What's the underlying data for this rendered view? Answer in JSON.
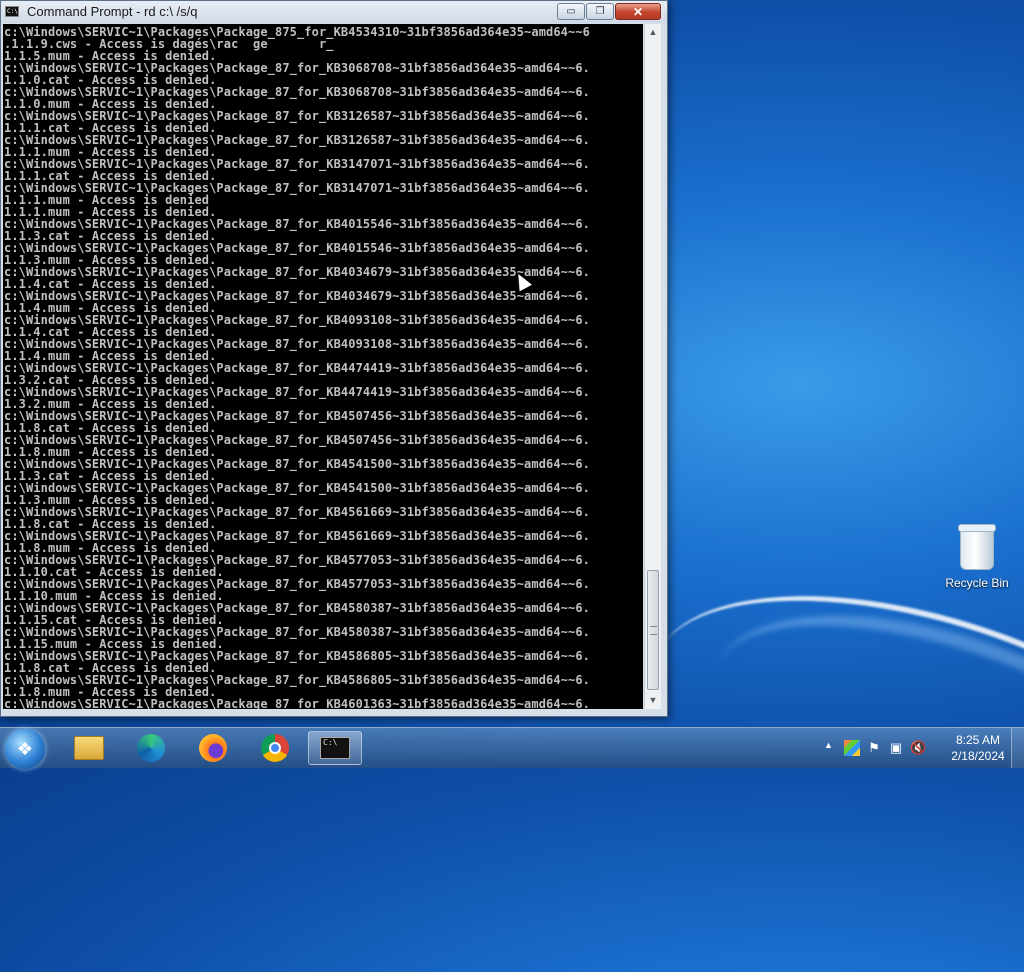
{
  "window": {
    "title": "Command Prompt - rd  c:\\ /s/q",
    "buttons": {
      "minimize": "▭",
      "maximize": "❐",
      "close": "✕"
    },
    "icon_text": "C:\\"
  },
  "console": {
    "lines": [
      "c:\\Windows\\SERVIC~1\\Packages\\Package_875_for_KB4534310~31bf3856ad364e35~amd64~~6",
      ".1.1.9.cws - Access is dagés\\rac  ge       r_",
      "1.1.5.mum - Access is denied.",
      "c:\\Windows\\SERVIC~1\\Packages\\Package_87_for_KB3068708~31bf3856ad364e35~amd64~~6.",
      "1.1.0.cat - Access is denied.",
      "c:\\Windows\\SERVIC~1\\Packages\\Package_87_for_KB3068708~31bf3856ad364e35~amd64~~6.",
      "1.1.0.mum - Access is denied.",
      "c:\\Windows\\SERVIC~1\\Packages\\Package_87_for_KB3126587~31bf3856ad364e35~amd64~~6.",
      "1.1.1.cat - Access is denied.",
      "c:\\Windows\\SERVIC~1\\Packages\\Package_87_for_KB3126587~31bf3856ad364e35~amd64~~6.",
      "1.1.1.mum - Access is denied.",
      "c:\\Windows\\SERVIC~1\\Packages\\Package_87_for_KB3147071~31bf3856ad364e35~amd64~~6.",
      "1.1.1.cat - Access is denied.",
      "c:\\Windows\\SERVIC~1\\Packages\\Package_87_for_KB3147071~31bf3856ad364e35~amd64~~6.",
      "1.1.1.mum - Access is denied",
      "1.1.1.mum - Access is denied.",
      "c:\\Windows\\SERVIC~1\\Packages\\Package_87_for_KB4015546~31bf3856ad364e35~amd64~~6.",
      "1.1.3.cat - Access is denied.",
      "c:\\Windows\\SERVIC~1\\Packages\\Package_87_for_KB4015546~31bf3856ad364e35~amd64~~6.",
      "1.1.3.mum - Access is denied.",
      "c:\\Windows\\SERVIC~1\\Packages\\Package_87_for_KB4034679~31bf3856ad364e35~amd64~~6.",
      "1.1.4.cat - Access is denied.",
      "c:\\Windows\\SERVIC~1\\Packages\\Package_87_for_KB4034679~31bf3856ad364e35~amd64~~6.",
      "1.1.4.mum - Access is denied.",
      "c:\\Windows\\SERVIC~1\\Packages\\Package_87_for_KB4093108~31bf3856ad364e35~amd64~~6.",
      "1.1.4.cat - Access is denied.",
      "c:\\Windows\\SERVIC~1\\Packages\\Package_87_for_KB4093108~31bf3856ad364e35~amd64~~6.",
      "1.1.4.mum - Access is denied.",
      "c:\\Windows\\SERVIC~1\\Packages\\Package_87_for_KB4474419~31bf3856ad364e35~amd64~~6.",
      "1.3.2.cat - Access is denied.",
      "c:\\Windows\\SERVIC~1\\Packages\\Package_87_for_KB4474419~31bf3856ad364e35~amd64~~6.",
      "1.3.2.mum - Access is denied.",
      "c:\\Windows\\SERVIC~1\\Packages\\Package_87_for_KB4507456~31bf3856ad364e35~amd64~~6.",
      "1.1.8.cat - Access is denied.",
      "c:\\Windows\\SERVIC~1\\Packages\\Package_87_for_KB4507456~31bf3856ad364e35~amd64~~6.",
      "1.1.8.mum - Access is denied.",
      "c:\\Windows\\SERVIC~1\\Packages\\Package_87_for_KB4541500~31bf3856ad364e35~amd64~~6.",
      "1.1.3.cat - Access is denied.",
      "c:\\Windows\\SERVIC~1\\Packages\\Package_87_for_KB4541500~31bf3856ad364e35~amd64~~6.",
      "1.1.3.mum - Access is denied.",
      "c:\\Windows\\SERVIC~1\\Packages\\Package_87_for_KB4561669~31bf3856ad364e35~amd64~~6.",
      "1.1.8.cat - Access is denied.",
      "c:\\Windows\\SERVIC~1\\Packages\\Package_87_for_KB4561669~31bf3856ad364e35~amd64~~6.",
      "1.1.8.mum - Access is denied.",
      "c:\\Windows\\SERVIC~1\\Packages\\Package_87_for_KB4577053~31bf3856ad364e35~amd64~~6.",
      "1.1.10.cat - Access is denied.",
      "c:\\Windows\\SERVIC~1\\Packages\\Package_87_for_KB4577053~31bf3856ad364e35~amd64~~6.",
      "1.1.10.mum - Access is denied.",
      "c:\\Windows\\SERVIC~1\\Packages\\Package_87_for_KB4580387~31bf3856ad364e35~amd64~~6.",
      "1.1.15.cat - Access is denied.",
      "c:\\Windows\\SERVIC~1\\Packages\\Package_87_for_KB4580387~31bf3856ad364e35~amd64~~6.",
      "1.1.15.mum - Access is denied.",
      "c:\\Windows\\SERVIC~1\\Packages\\Package_87_for_KB4586805~31bf3856ad364e35~amd64~~6.",
      "1.1.8.cat - Access is denied.",
      "c:\\Windows\\SERVIC~1\\Packages\\Package_87_for_KB4586805~31bf3856ad364e35~amd64~~6.",
      "1.1.8.mum - Access is denied.",
      "c:\\Windows\\SERVIC~1\\Packages\\Package_87_for_KB4601363~31bf3856ad364e35~amd64~~6."
    ]
  },
  "desktop": {
    "icons": [
      {
        "label": "Recycle Bin",
        "icon": "recycle-bin-icon"
      }
    ]
  },
  "taskbar": {
    "start_icon": "windows-logo-icon",
    "pinned": [
      {
        "name": "file-explorer",
        "icon": "folder-icon"
      },
      {
        "name": "edge",
        "icon": "edge-icon"
      },
      {
        "name": "firefox",
        "icon": "firefox-icon"
      },
      {
        "name": "chrome",
        "icon": "chrome-icon"
      },
      {
        "name": "command-prompt",
        "icon": "cmd-icon",
        "active": true
      }
    ],
    "tray": {
      "show_hidden_glyph": "▲",
      "icons": [
        "network-icon",
        "flag-icon",
        "display-icon",
        "volume-muted-icon"
      ],
      "time": "8:25 AM",
      "date": "2/18/2024"
    }
  },
  "colors": {
    "console_bg": "#000000",
    "console_fg": "#c0c0c0",
    "close_button": "#c5452d",
    "desktop_blue": "#1a6fce"
  }
}
